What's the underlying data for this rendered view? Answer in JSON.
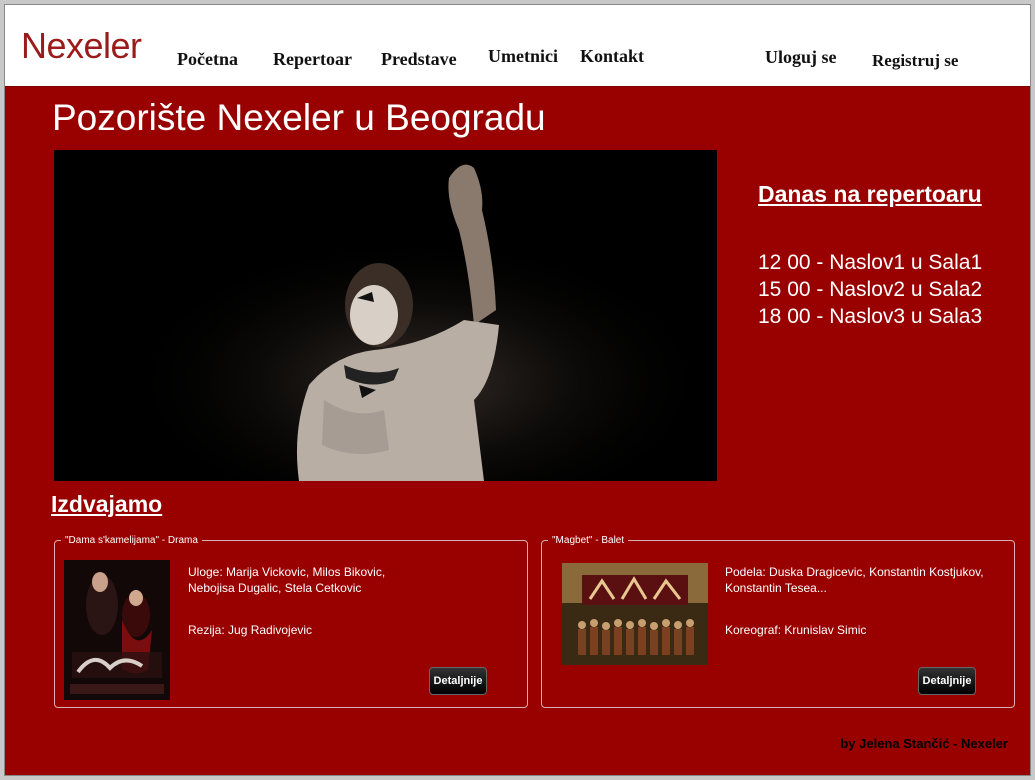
{
  "header": {
    "logo": "Nexeler",
    "nav": [
      "Početna",
      "Repertoar",
      "Predstave",
      "Umetnici",
      "Kontakt"
    ],
    "login": "Uloguj se",
    "register": "Registruj se"
  },
  "main": {
    "title": "Pozorište Nexeler u Beogradu",
    "today": {
      "heading": "Danas na repertoaru",
      "items": [
        "12 00 - Naslov1 u Sala1",
        "15 00 - Naslov2 u Sala2",
        "18 00 - Naslov3 u Sala3"
      ]
    },
    "featured": {
      "heading": "Izdvajamo",
      "cards": [
        {
          "legend": "\"Dama s'kamelijama\" - Drama",
          "cast": "Uloge: Marija Vickovic, Milos Bikovic, Nebojisa Dugalic, Stela Cetkovic",
          "crew": "Rezija: Jug Radivojevic",
          "button": "Detaljnije"
        },
        {
          "legend": "\"Magbet\" - Balet",
          "cast": "Podela: Duska Dragicevic, Konstantin Kostjukov, Konstantin Tesea...",
          "crew": "Koreograf: Krunislav Simic",
          "button": "Detaljnije"
        }
      ]
    }
  },
  "footer": {
    "credit": "by Jelena Stančić - Nexeler"
  },
  "colors": {
    "background": "#990000",
    "header": "#ffffff",
    "logo": "#9b1b1b"
  }
}
